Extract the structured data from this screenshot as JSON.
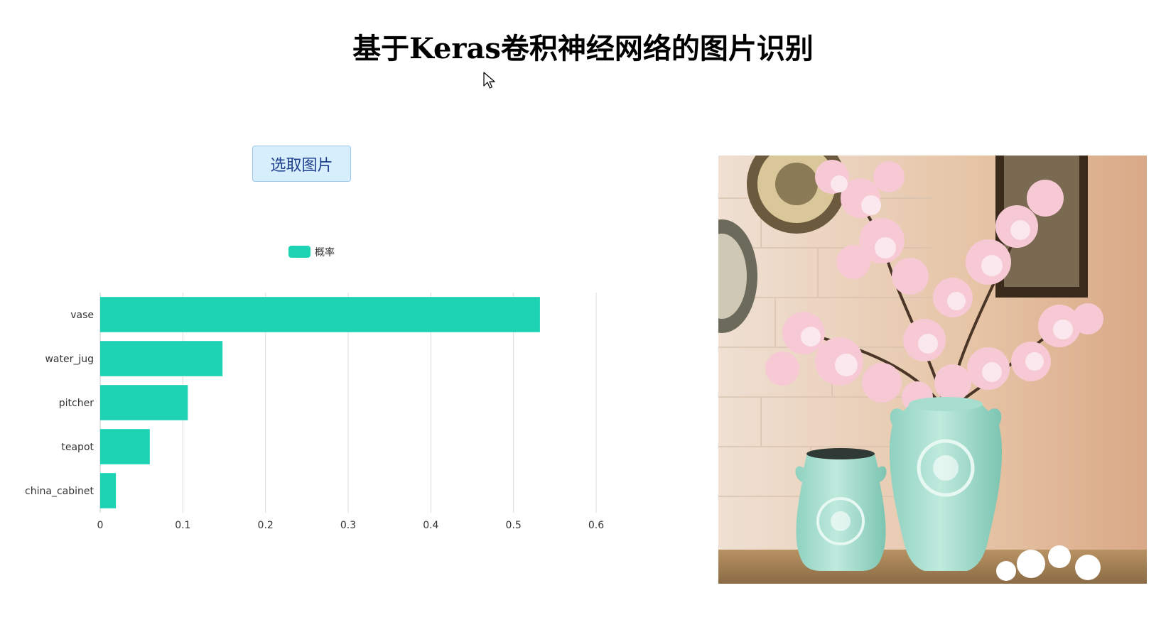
{
  "page": {
    "title": "基于Keras卷积神经网络的图片识别",
    "pick_button_label": "选取图片"
  },
  "colors": {
    "bar": "#1dd3b4",
    "grid": "#dcdcdc",
    "axis_text": "#333333",
    "button_bg": "#d7eefc",
    "button_text": "#1f3f8f"
  },
  "chart_data": {
    "type": "bar",
    "orientation": "horizontal",
    "categories": [
      "vase",
      "water_jug",
      "pitcher",
      "teapot",
      "china_cabinet"
    ],
    "series": [
      {
        "name": "概率",
        "values": [
          0.532,
          0.148,
          0.106,
          0.06,
          0.019
        ]
      }
    ],
    "xlim": [
      0,
      0.6
    ],
    "xticks": [
      "0",
      "0.1",
      "0.2",
      "0.3",
      "0.4",
      "0.5",
      "0.6"
    ],
    "grid": true,
    "legend_position": "top-center"
  },
  "image": {
    "icon": "flower-vase-photo"
  }
}
